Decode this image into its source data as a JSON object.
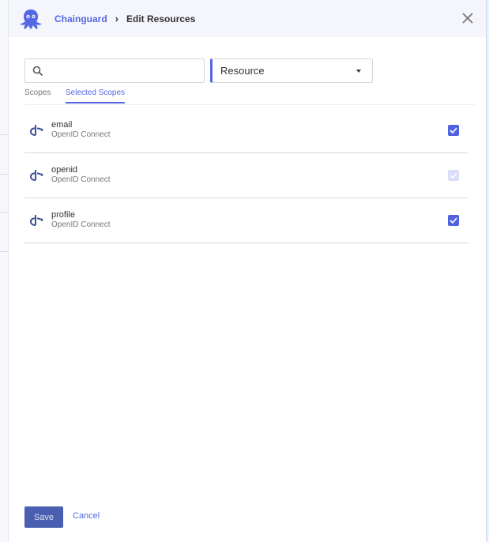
{
  "header": {
    "brand": "Chainguard",
    "separator": "›",
    "title": "Edit Resources"
  },
  "search": {
    "value": "",
    "placeholder": ""
  },
  "filter": {
    "selected": "Resource"
  },
  "tabs": [
    {
      "label": "Scopes",
      "active": false
    },
    {
      "label": "Selected Scopes",
      "active": true
    }
  ],
  "scopes": [
    {
      "name": "email",
      "type": "OpenID Connect",
      "checked": true,
      "disabled": false
    },
    {
      "name": "openid",
      "type": "OpenID Connect",
      "checked": true,
      "disabled": true
    },
    {
      "name": "profile",
      "type": "OpenID Connect",
      "checked": true,
      "disabled": false
    }
  ],
  "footer": {
    "save_label": "Save",
    "cancel_label": "Cancel"
  },
  "colors": {
    "accent": "#5468e3",
    "save_button": "#4a5fb0",
    "header_bg": "#f5f6fb"
  }
}
